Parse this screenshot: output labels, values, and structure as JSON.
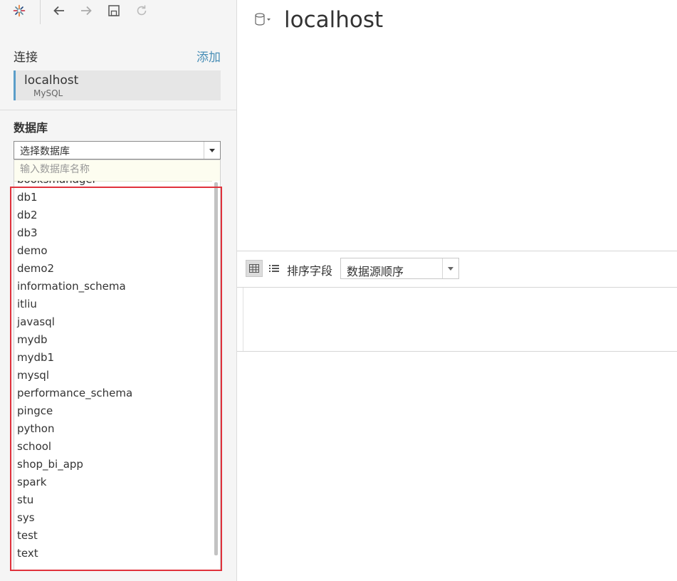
{
  "toolbar": {
    "items": [
      "app-logo-icon",
      "back-icon",
      "forward-icon",
      "save-icon",
      "refresh-icon"
    ]
  },
  "sidebar": {
    "connections_title": "连接",
    "add_label": "添加",
    "connection": {
      "name": "localhost",
      "type": "MySQL"
    },
    "database_title": "数据库",
    "database_select_value": "选择数据库",
    "database_search_placeholder": "输入数据库名称",
    "databases": [
      "booksmanager",
      "db1",
      "db2",
      "db3",
      "demo",
      "demo2",
      "information_schema",
      "itliu",
      "javasql",
      "mydb",
      "mydb1",
      "mysql",
      "performance_schema",
      "pingce",
      "python",
      "school",
      "shop_bi_app",
      "spark",
      "stu",
      "sys",
      "test",
      "text"
    ]
  },
  "main": {
    "title": "localhost",
    "sort_label": "排序字段",
    "sort_value": "数据源顺序"
  },
  "colors": {
    "accent": "#4a8fb7",
    "highlight": "#e0323c"
  }
}
